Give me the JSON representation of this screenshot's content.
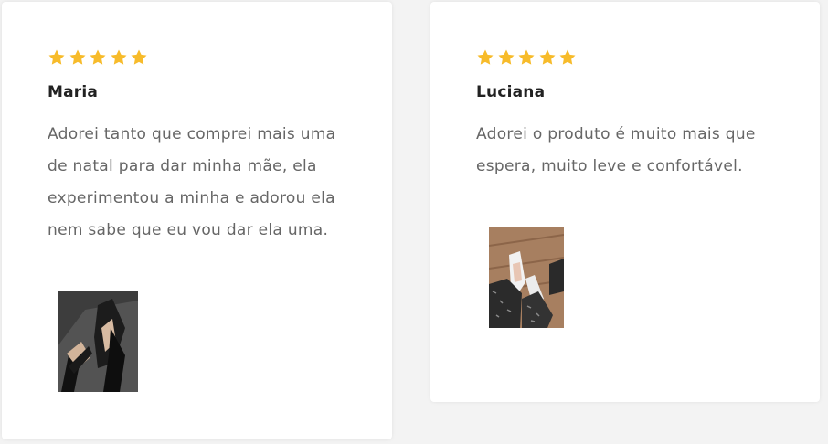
{
  "reviews": [
    {
      "rating": 5,
      "name": "Maria",
      "text": "Adorei tanto que comprei mais uma de natal para dar minha mãe, ela experimentou a minha e adorou ela nem sabe que eu vou dar ela uma.",
      "photo_icon": "black-sandals-photo"
    },
    {
      "rating": 5,
      "name": "Luciana",
      "text": "Adorei o produto é muito mais que espera, muito leve e confortável.",
      "photo_icon": "white-sandals-photo"
    }
  ],
  "colors": {
    "star": "#f7bb2a",
    "name": "#222222",
    "text": "#666666",
    "card": "#ffffff",
    "background": "#f3f3f3"
  }
}
